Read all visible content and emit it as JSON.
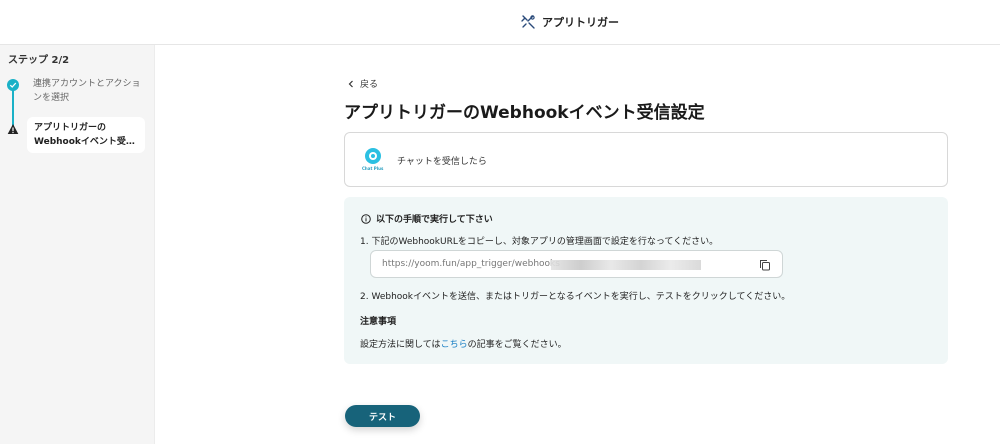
{
  "header": {
    "title": "アプリトリガー",
    "icon": "tools-icon"
  },
  "sidebar": {
    "step_count": "ステップ 2/2",
    "steps": [
      {
        "label": "連携アカウントとアクションを選択",
        "status": "done",
        "icon": "check-icon"
      },
      {
        "label_line1": "アプリトリガーの",
        "label_line2": "Webhookイベント受信設定",
        "status": "warning",
        "icon": "warning-icon"
      }
    ]
  },
  "main": {
    "back_label": "戻る",
    "title": "アプリトリガーのWebhookイベント受信設定",
    "app": {
      "logo_text": "Chat Plus",
      "trigger": "チャットを受信したら"
    },
    "guide": {
      "heading": "以下の手順で実行して下さい",
      "step1": "1. 下記のWebhookURLをコピーし、対象アプリの管理画面で設定を行なってください。",
      "url": "https://yoom.fun/app_trigger/webhooks",
      "step2": "2. Webhookイベントを送信、またはトリガーとなるイベントを実行し、テストをクリックしてください。",
      "notes_title": "注意事項",
      "notes_before": "設定方法に関しては",
      "notes_link": "こちら",
      "notes_after": "の記事をご覧ください。"
    },
    "test_button": "テスト"
  },
  "colors": {
    "accent": "#1ab1c7",
    "button": "#17637a",
    "link": "#1a7fc4",
    "guide_bg": "#f0f7f7"
  }
}
